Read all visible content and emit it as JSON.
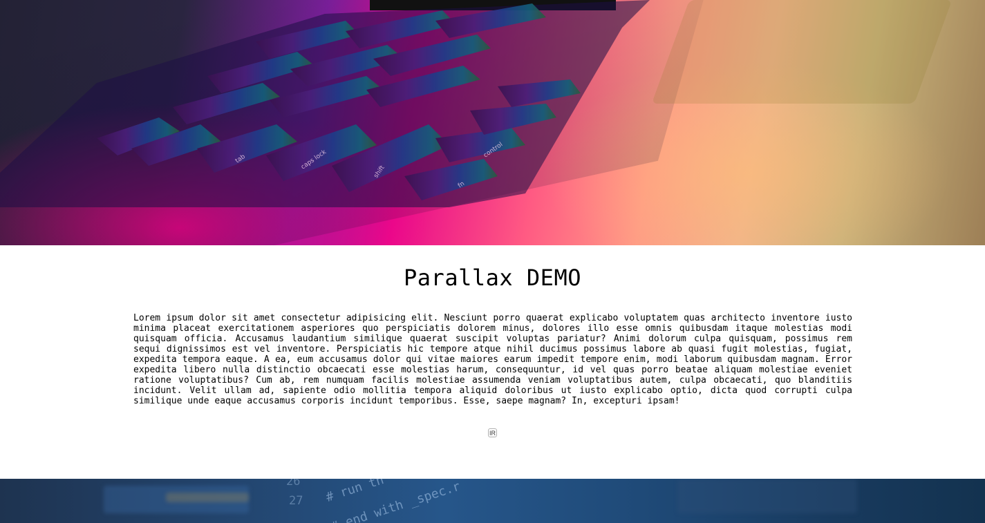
{
  "hero": {
    "image": "laptop-keyboard-rainbow-photo",
    "keycaps": [
      "caps lock",
      "shift",
      "fn",
      "control",
      "tab"
    ]
  },
  "content": {
    "title": "Parallax DEMO",
    "paragraph": "Lorem ipsum dolor sit amet consectetur adipisicing elit. Nesciunt porro quaerat explicabo voluptatem quas architecto inventore iusto minima placeat exercitationem asperiores quo perspiciatis dolorem minus, dolores illo esse omnis quibusdam itaque molestias modi quisquam officia. Accusamus laudantium similique quaerat suscipit voluptas pariatur? Animi dolorum culpa quisquam, possimus rem sequi dignissimos est vel inventore. Perspiciatis hic tempore atque nihil ducimus possimus labore ab quasi fugit molestias, fugiat, expedita tempora eaque. A ea, eum accusamus dolor qui vitae maiores earum impedit tempore enim, modi laborum quibusdam magnam. Error expedita libero nulla distinctio obcaecati esse molestias harum, consequuntur, id vel quas porro beatae aliquam molestiae eveniet ratione voluptatibus? Cum ab, rem numquam facilis molestiae assumenda veniam voluptatibus autem, culpa obcaecati, quo blanditiis incidunt. Velit ullam ad, sapiente odio mollitia tempora aliquid doloribus ut iusto explicabo optio, dicta quod corrupti culpa similique unde eaque accusamus corporis incidunt temporibus. Esse, saepe magnam? In, excepturi ipsam!",
    "button_label": "IR"
  },
  "code_banner": {
    "image": "code-editor-photo",
    "lines": [
      "# run th",
      "# end with _spec.r"
    ],
    "line_numbers": [
      "26",
      "27"
    ]
  },
  "colors": {
    "background": "#ffffff",
    "text": "#000000",
    "dark_tab": "#111111"
  }
}
